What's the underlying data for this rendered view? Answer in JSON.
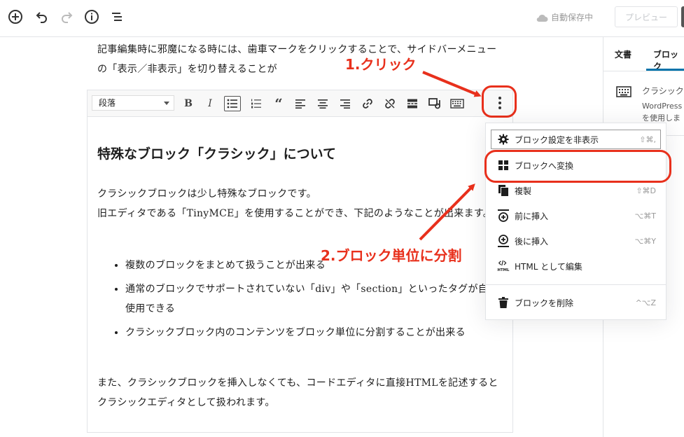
{
  "topbar": {
    "icons": [
      "add-block-icon",
      "undo-icon",
      "redo-icon",
      "info-icon",
      "outline-icon"
    ],
    "autosave_label": "自動保存中",
    "preview_label": "プレビュー"
  },
  "sidebar": {
    "tabs": [
      {
        "label": "文書"
      },
      {
        "label": "ブロック"
      }
    ],
    "block_title": "クラシック",
    "block_desc_line1": "WordPress",
    "block_desc_line2": "を使用しま"
  },
  "editor": {
    "top_paragraph": "記事編集時に邪魔になる時には、歯車マークをクリックすることで、サイドバーメニューの「表示／非表示」を切り替えることが",
    "format_select": "段落",
    "heading": "特殊なブロック「クラシック」について",
    "paragraph1_line1": "クラシックブロックは少し特殊なブロックです。",
    "paragraph1_line2": "旧エディタである「TinyMCE」を使用することができ、下記のようなことが出来ます。",
    "bullets": [
      "複数のブロックをまとめて扱うことが出来る",
      "通常のブロックでサポートされていない「div」や「section」といったタグが自由に使用できる",
      "クラシックブロック内のコンテンツをブロック単位に分割することが出来る"
    ],
    "paragraph2": "また、クラシックブロックを挿入しなくても、コードエディタに直接HTMLを記述するとクラシックエディタとして扱われます。"
  },
  "menu": {
    "items": [
      {
        "label": "ブロック設定を非表示",
        "shortcut": "⇧⌘,",
        "icon": "gear-icon"
      },
      {
        "label": "ブロックへ変換",
        "shortcut": "",
        "icon": "blocks-icon"
      },
      {
        "label": "複製",
        "shortcut": "⇧⌘D",
        "icon": "duplicate-icon"
      },
      {
        "label": "前に挿入",
        "shortcut": "⌥⌘T",
        "icon": "insert-before-icon"
      },
      {
        "label": "後に挿入",
        "shortcut": "⌥⌘Y",
        "icon": "insert-after-icon"
      },
      {
        "label": "HTML として編集",
        "shortcut": "",
        "icon": "html-icon"
      },
      {
        "label": "ブロックを削除",
        "shortcut": "^⌥Z",
        "icon": "trash-icon"
      }
    ]
  },
  "annotations": {
    "step1": "1.クリック",
    "step2": "2.ブロック単位に分割"
  },
  "colors": {
    "annotation_red": "#e8301c",
    "accent_blue": "#0073aa"
  }
}
